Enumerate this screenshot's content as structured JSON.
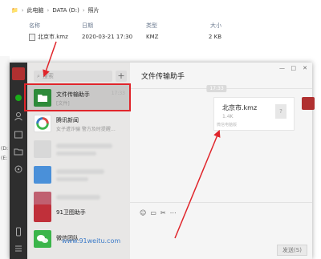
{
  "explorer": {
    "breadcrumb": [
      "此电脑",
      "DATA (D:)",
      "照片"
    ],
    "headers": {
      "name": "名称",
      "date": "日期",
      "type": "类型",
      "size": "大小"
    },
    "file": {
      "name": "北京市.kmz",
      "date": "2020-03-21 17:30",
      "type": "KMZ",
      "size": "2 KB"
    },
    "left_labels": [
      "(D:",
      "(E:"
    ]
  },
  "wechat": {
    "search_placeholder": "搜索",
    "add_label": "+",
    "chats": [
      {
        "name": "文件传输助手",
        "sub": "[文件]",
        "time": "17:33",
        "avatar_color": "#2e8b3a"
      },
      {
        "name": "腾讯新闻",
        "sub": "女子遭诈骗 警方及时提醒…",
        "time": "",
        "avatar_color": "#e04545"
      },
      {
        "name": "",
        "sub": "",
        "time": "",
        "avatar_color": "#d0d0d0"
      },
      {
        "name": "",
        "sub": "",
        "time": "",
        "avatar_color": "#4a90d9"
      },
      {
        "name": "",
        "sub": "",
        "time": "",
        "avatar_color": "#c06070"
      },
      {
        "name": "91卫图助手",
        "sub": "",
        "time": "",
        "avatar_color": "#c0303a"
      },
      {
        "name": "微信团队",
        "sub": "",
        "time": "",
        "avatar_color": "#3bb54a"
      }
    ],
    "chat": {
      "title": "文件传输助手",
      "time_chip": "17:33",
      "file_name": "北京市.kmz",
      "file_size": "1.4K",
      "file_source": "微信电脑版",
      "send_label": "发送(S)",
      "win_controls": [
        "—",
        "□",
        "✕"
      ],
      "toolbar_icons": [
        "☺",
        "▭",
        "✂",
        "⋯"
      ]
    }
  },
  "watermark": "www.91weitu.com",
  "accent": {
    "highlight": "#e0252b",
    "wechat_green": "#1aad19"
  }
}
